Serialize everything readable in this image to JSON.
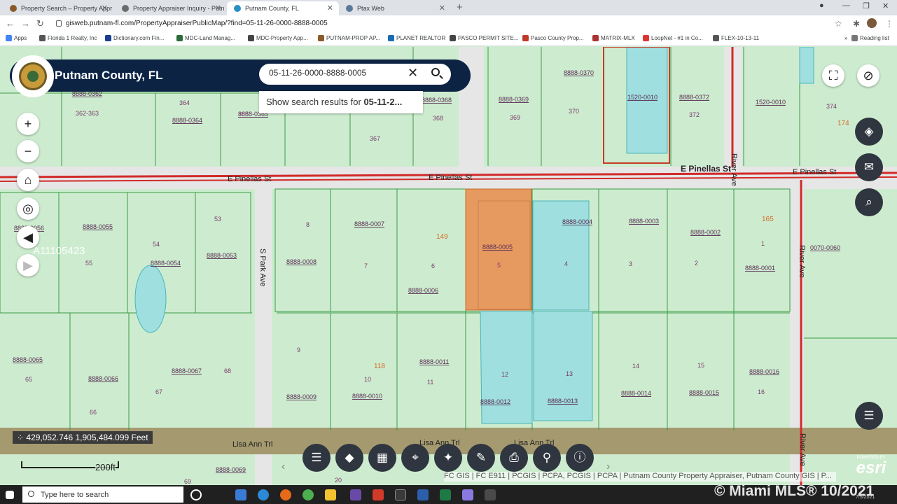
{
  "browser": {
    "tabs": [
      {
        "title": "Property Search – Property Appr",
        "active": false
      },
      {
        "title": "Property Appraiser Inquiry - Putn",
        "active": false
      },
      {
        "title": "Putnam County, FL",
        "active": true
      },
      {
        "title": "Ptax Web",
        "active": false
      }
    ],
    "url": "gisweb.putnam-fl.com/PropertyAppraiserPublicMap/?find=05-11-26-0000-8888-0005",
    "bookmarks": [
      "Apps",
      "Florida 1 Realty, Inc",
      "Dictionary.com Fin...",
      "MDC-Land Manag...",
      "MDC-Property App...",
      "PUTNAM-PROP AP...",
      "PLANET REALTOR",
      "PASCO PERMIT SITE...",
      "Pasco County Prop...",
      "MATRIX-MLX",
      "LoopNet - #1 in Co...",
      "FLEX-10-13-11"
    ],
    "reading_list": "Reading list"
  },
  "map": {
    "title": "Putnam County, FL",
    "search_value": "05-11-26-0000-8888-0005",
    "suggestion_prefix": "Show search results for ",
    "suggestion_term": "05-11-2...",
    "watermark": "A11105423",
    "coordinates": "429,052.746 1,905,484.099 Feet",
    "scale_label": "200ft",
    "attribution": "FC GIS | FC E911 | PCGIS | PCPA, PCGIS | PCPA | Putnam County Property Appraiser, Putnam County GIS | P...",
    "esri_powered": "POWERED BY",
    "esri_logo": "esri",
    "roads": {
      "pinellas": "E Pinellas St",
      "river": "River Ave",
      "park": "S Park Ave",
      "lisa": "Lisa Ann Trl"
    },
    "parcels": [
      {
        "label": "8888-0362",
        "num": "362-363"
      },
      {
        "label": "8888-0364",
        "num": "364"
      },
      {
        "label": "8888-0365",
        "num": "365"
      },
      {
        "label": "8888-0368",
        "num": "368"
      },
      {
        "label": "8888-0369",
        "num": "369"
      },
      {
        "label": "8888-0370",
        "num": "370"
      },
      {
        "label": "1520-0010",
        "num": ""
      },
      {
        "label": "8888-0372",
        "num": "372"
      },
      {
        "label": "1520-0010",
        "num": "374"
      },
      {
        "label": "8888-0056",
        "num": ""
      },
      {
        "label": "8888-0055",
        "num": "55"
      },
      {
        "label": "8888-0054",
        "num": "54"
      },
      {
        "label": "8888-0053",
        "num": "53"
      },
      {
        "label": "8888-0008",
        "num": "8"
      },
      {
        "label": "8888-0007",
        "num": "7"
      },
      {
        "label": "8888-0006",
        "num": "6"
      },
      {
        "label": "8888-0005",
        "num": "5"
      },
      {
        "label": "8888-0004",
        "num": "4"
      },
      {
        "label": "8888-0003",
        "num": "3"
      },
      {
        "label": "8888-0002",
        "num": "2"
      },
      {
        "label": "8888-0001",
        "num": "1"
      },
      {
        "label": "0070-0060",
        "num": ""
      },
      {
        "label": "8888-0065",
        "num": "65"
      },
      {
        "label": "8888-0066",
        "num": "66"
      },
      {
        "label": "8888-0067",
        "num": "67"
      },
      {
        "label": "8888-0009",
        "num": "9"
      },
      {
        "label": "8888-0010",
        "num": "10"
      },
      {
        "label": "8888-0011",
        "num": "11"
      },
      {
        "label": "8888-0012",
        "num": "12"
      },
      {
        "label": "8888-0013",
        "num": "13"
      },
      {
        "label": "8888-0014",
        "num": "14"
      },
      {
        "label": "8888-0015",
        "num": "15"
      },
      {
        "label": "8888-0016",
        "num": "16"
      },
      {
        "label": "8888-0069",
        "num": "69"
      }
    ],
    "misc_numbers": [
      "367",
      "68",
      "20"
    ],
    "orange_numbers": [
      "149",
      "118",
      "165",
      "174"
    ],
    "toolbar": [
      "list-icon",
      "layers-icon",
      "grid-icon",
      "location-pin-icon",
      "measure-icon",
      "draw-icon",
      "print-icon",
      "share-icon",
      "info-icon"
    ]
  },
  "taskbar": {
    "search_placeholder": "Type here to search",
    "mls_watermark": "© Miami MLS® 10/2021",
    "clock_date": "7/5/2021"
  }
}
